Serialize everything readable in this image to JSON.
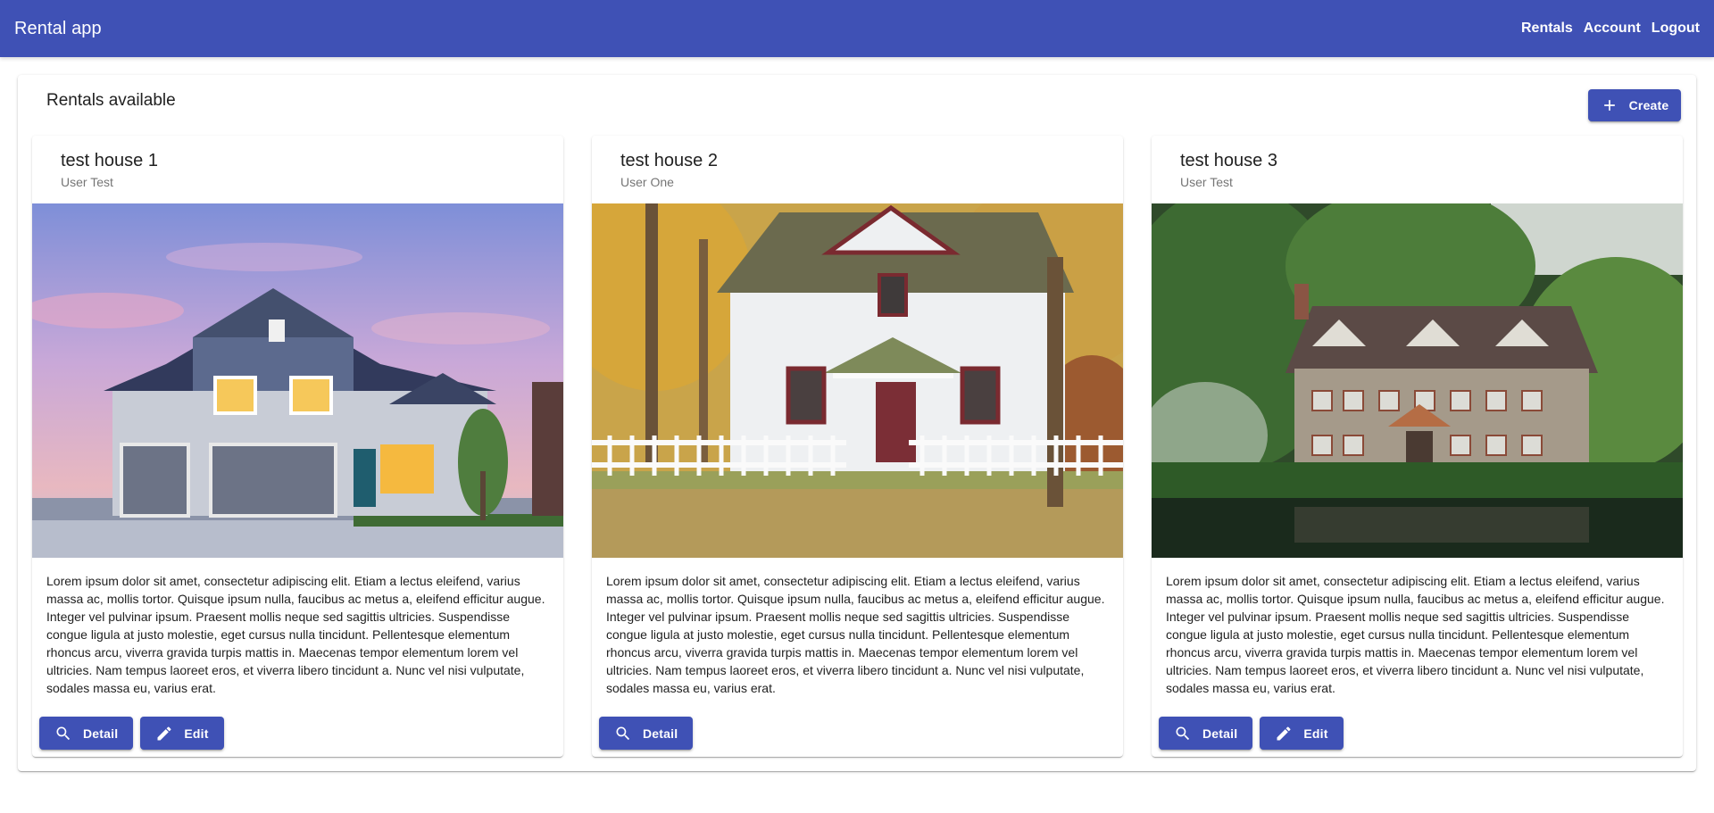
{
  "toolbar": {
    "title": "Rental app",
    "nav": [
      "Rentals",
      "Account",
      "Logout"
    ]
  },
  "main": {
    "title": "Rentals available",
    "create_label": "Create",
    "rentals": [
      {
        "title": "test house 1",
        "owner": "User Test",
        "description": "Lorem ipsum dolor sit amet, consectetur adipiscing elit. Etiam a lectus eleifend, varius massa ac, mollis tortor. Quisque ipsum nulla, faucibus ac metus a, eleifend efficitur augue. Integer vel pulvinar ipsum. Praesent mollis neque sed sagittis ultricies. Suspendisse congue ligula at justo molestie, eget cursus nulla tincidunt. Pellentesque elementum rhoncus arcu, viverra gravida turpis mattis in. Maecenas tempor elementum lorem vel ultricies. Nam tempus laoreet eros, et viverra libero tincidunt a. Nunc vel nisi vulputate, sodales massa eu, varius erat.",
        "detail_label": "Detail",
        "edit_label": "Edit"
      },
      {
        "title": "test house 2",
        "owner": "User One",
        "description": "Lorem ipsum dolor sit amet, consectetur adipiscing elit. Etiam a lectus eleifend, varius massa ac, mollis tortor. Quisque ipsum nulla, faucibus ac metus a, eleifend efficitur augue. Integer vel pulvinar ipsum. Praesent mollis neque sed sagittis ultricies. Suspendisse congue ligula at justo molestie, eget cursus nulla tincidunt. Pellentesque elementum rhoncus arcu, viverra gravida turpis mattis in. Maecenas tempor elementum lorem vel ultricies. Nam tempus laoreet eros, et viverra libero tincidunt a. Nunc vel nisi vulputate, sodales massa eu, varius erat.",
        "detail_label": "Detail"
      },
      {
        "title": "test house 3",
        "owner": "User Test",
        "description": "Lorem ipsum dolor sit amet, consectetur adipiscing elit. Etiam a lectus eleifend, varius massa ac, mollis tortor. Quisque ipsum nulla, faucibus ac metus a, eleifend efficitur augue. Integer vel pulvinar ipsum. Praesent mollis neque sed sagittis ultricies. Suspendisse congue ligula at justo molestie, eget cursus nulla tincidunt. Pellentesque elementum rhoncus arcu, viverra gravida turpis mattis in. Maecenas tempor elementum lorem vel ultricies. Nam tempus laoreet eros, et viverra libero tincidunt a. Nunc vel nisi vulputate, sodales massa eu, varius erat.",
        "detail_label": "Detail",
        "edit_label": "Edit"
      }
    ]
  },
  "colors": {
    "primary": "#3f51b5",
    "text": "#212121",
    "subtitle": "#757575"
  }
}
